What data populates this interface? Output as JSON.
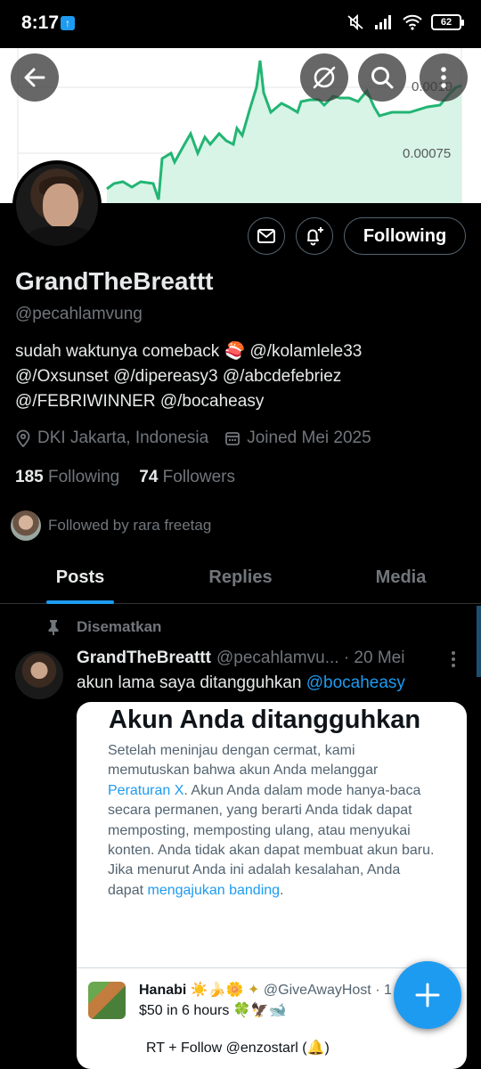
{
  "status_bar": {
    "time": "8:17",
    "battery": "62"
  },
  "banner": {
    "tick_labels": [
      "0.0010",
      "0.00075"
    ],
    "line_color": "#22b573",
    "fill_color": "#d7f4e6"
  },
  "header_buttons": {
    "back_icon": "arrow-left-icon",
    "grok_icon": "grok-icon",
    "search_icon": "search-icon",
    "more_icon": "more-vertical-icon"
  },
  "profile": {
    "display_name": "GrandTheBreattt",
    "handle": "@pecahlamvung",
    "bio": "sudah waktunya comeback 🍣 @/kolamlele33 @/Oxsunset @/dipereasy3 @/abcdefebriez @/FEBRIWINNER @/bocaheasy",
    "location": "DKI Jakarta, Indonesia",
    "joined": "Joined Mei 2025",
    "following_count": "185",
    "following_label": "Following",
    "followers_count": "74",
    "followers_label": "Followers",
    "followed_by": "Followed by rara freetag",
    "follow_button": "Following"
  },
  "tabs": [
    {
      "label": "Posts",
      "active": true
    },
    {
      "label": "Replies",
      "active": false
    },
    {
      "label": "Media",
      "active": false
    }
  ],
  "post": {
    "pinned_label": "Disematkan",
    "author": "GrandTheBreattt",
    "handle": "@pecahlamvu...",
    "date": "· 20 Mei",
    "text": "akun lama saya ditangguhkan ",
    "mention": "@bocaheasy",
    "card": {
      "title": "Akun Anda ditangguhkan",
      "body_1": "Setelah meninjau dengan cermat, kami memutuskan bahwa akun Anda melanggar ",
      "link_1": "Peraturan X",
      "body_2": ". Akun Anda dalam mode hanya-baca secara permanen, yang berarti Anda tidak dapat memposting, memposting ulang, atau menyukai konten. Anda tidak akan dapat membuat akun baru. Jika menurut Anda ini adalah kesalahan, Anda dapat ",
      "link_2": "mengajukan banding",
      "body_3": ".",
      "embedded": {
        "name": "Hanabi ☀️🍌🌼",
        "handle": "@GiveAwayHost · 1 ja",
        "text": "$50 in 6 hours 🍀🦅🐋",
        "text2": "RT + Follow @enzostarl (🔔)"
      }
    }
  },
  "fab": {
    "icon": "plus-icon"
  }
}
